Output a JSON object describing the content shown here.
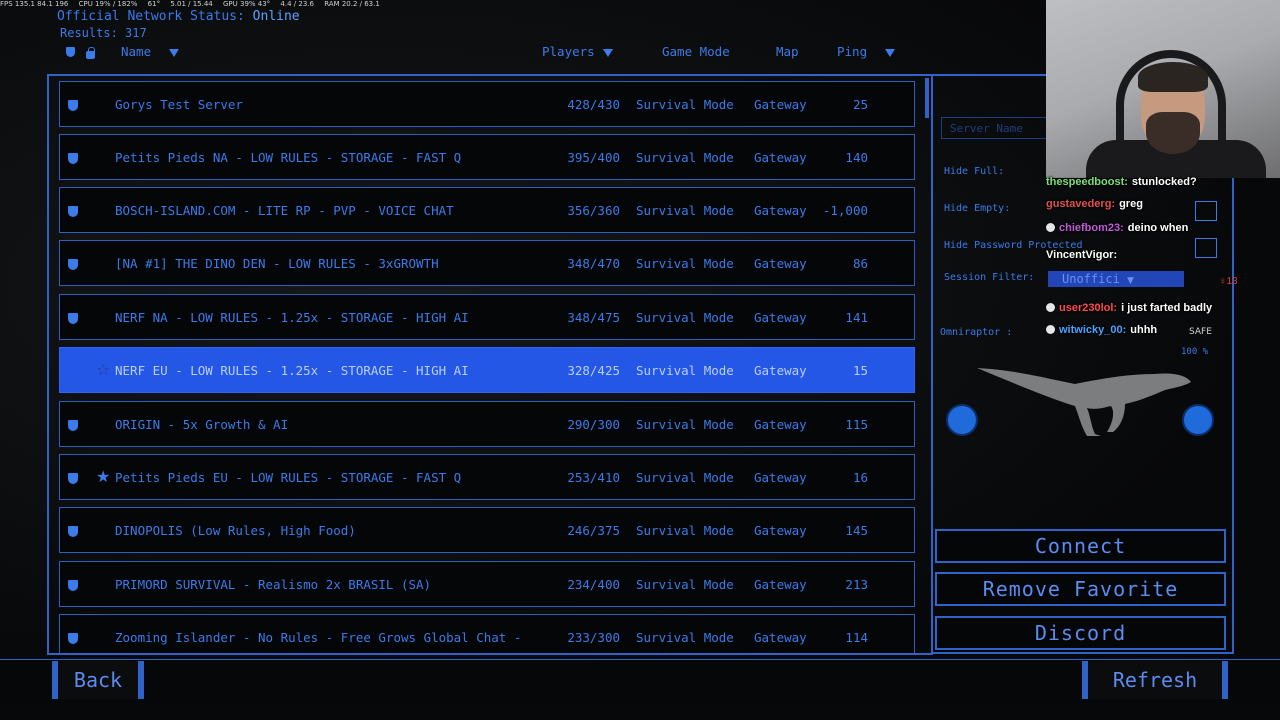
{
  "osd": {
    "fps": "FPS 135.1 84.1 196",
    "cpu": "CPU 19% / 182%",
    "temp": "61°",
    "mem": "5.01 / 15.44",
    "gpu": "GPU 39%  43°",
    "vram": "4.4 / 23.6",
    "ram": "RAM 20.2 / 63.1"
  },
  "status": {
    "label": "Official Network Status:",
    "value": "Online"
  },
  "results": {
    "label": "Results:",
    "count": "317"
  },
  "headers": {
    "name": "Name",
    "players": "Players",
    "mode": "Game Mode",
    "map": "Map",
    "ping": "Ping"
  },
  "servers": [
    {
      "name": "Gorys Test Server",
      "players": "428/430",
      "mode": "Survival Mode",
      "map": "Gateway",
      "ping": "25",
      "favorite": false,
      "selected": false
    },
    {
      "name": "Petits Pieds NA - LOW RULES - STORAGE - FAST Q",
      "players": "395/400",
      "mode": "Survival Mode",
      "map": "Gateway",
      "ping": "140",
      "favorite": false,
      "selected": false
    },
    {
      "name": "BOSCH-ISLAND.COM - LITE RP - PVP - VOICE CHAT",
      "players": "356/360",
      "mode": "Survival Mode",
      "map": "Gateway",
      "ping": "-1,000",
      "favorite": false,
      "selected": false
    },
    {
      "name": "[NA #1] THE DINO DEN - LOW RULES - 3xGROWTH",
      "players": "348/470",
      "mode": "Survival Mode",
      "map": "Gateway",
      "ping": "86",
      "favorite": false,
      "selected": false
    },
    {
      "name": "NERF NA - LOW RULES - 1.25x - STORAGE - HIGH AI",
      "players": "348/475",
      "mode": "Survival Mode",
      "map": "Gateway",
      "ping": "141",
      "favorite": false,
      "selected": false
    },
    {
      "name": "NERF EU - LOW RULES - 1.25x - STORAGE - HIGH AI",
      "players": "328/425",
      "mode": "Survival Mode",
      "map": "Gateway",
      "ping": "15",
      "favorite": true,
      "selected": true
    },
    {
      "name": "ORIGIN - 5x Growth & AI",
      "players": "290/300",
      "mode": "Survival Mode",
      "map": "Gateway",
      "ping": "115",
      "favorite": false,
      "selected": false
    },
    {
      "name": "Petits Pieds EU - LOW RULES - STORAGE - FAST Q",
      "players": "253/410",
      "mode": "Survival Mode",
      "map": "Gateway",
      "ping": "16",
      "favorite": true,
      "selected": false
    },
    {
      "name": "DINOPOLIS (Low Rules, High Food)",
      "players": "246/375",
      "mode": "Survival Mode",
      "map": "Gateway",
      "ping": "145",
      "favorite": false,
      "selected": false
    },
    {
      "name": "PRIMORD SURVIVAL - Realismo 2x BRASIL (SA)",
      "players": "234/400",
      "mode": "Survival Mode",
      "map": "Gateway",
      "ping": "213",
      "favorite": false,
      "selected": false
    },
    {
      "name": "Zooming Islander - No Rules - Free Grows  Global Chat -",
      "players": "233/300",
      "mode": "Survival Mode",
      "map": "Gateway",
      "ping": "114",
      "favorite": false,
      "selected": false
    }
  ],
  "filters": {
    "server_name_placeholder": "Server Name",
    "hide_full": "Hide Full:",
    "hide_empty": "Hide Empty:",
    "hide_password": "Hide Password Protected",
    "session_filter": "Session Filter:",
    "session_value": "Unoffici"
  },
  "creature": {
    "name": "Omniraptor :",
    "status": "SAFE",
    "growth": "100 %"
  },
  "buttons": {
    "connect": "Connect",
    "remove_favorite": "Remove Favorite",
    "discord": "Discord",
    "back": "Back",
    "refresh": "Refresh"
  },
  "chat": [
    {
      "user": "thespeedboost:",
      "text": "stunlocked?",
      "color": "#7be07b"
    },
    {
      "user": "gustavederg:",
      "text": "greg",
      "color": "#e05050"
    },
    {
      "user": "chiefbom23:",
      "text": "deino when",
      "color": "#c05ad6"
    },
    {
      "user": "VincentVigor:",
      "text": "",
      "color": "#ffffff"
    },
    {
      "user": "user230lol:",
      "text": "i just farted badly",
      "color": "#ff4a4a"
    },
    {
      "user": "witwicky_00:",
      "text": "uhhh",
      "color": "#4aa3ff"
    }
  ],
  "viewers": "13",
  "colors": {
    "accent": "#3b7bea",
    "selected_row": "#2557e6",
    "frame": "#2f63c8"
  }
}
